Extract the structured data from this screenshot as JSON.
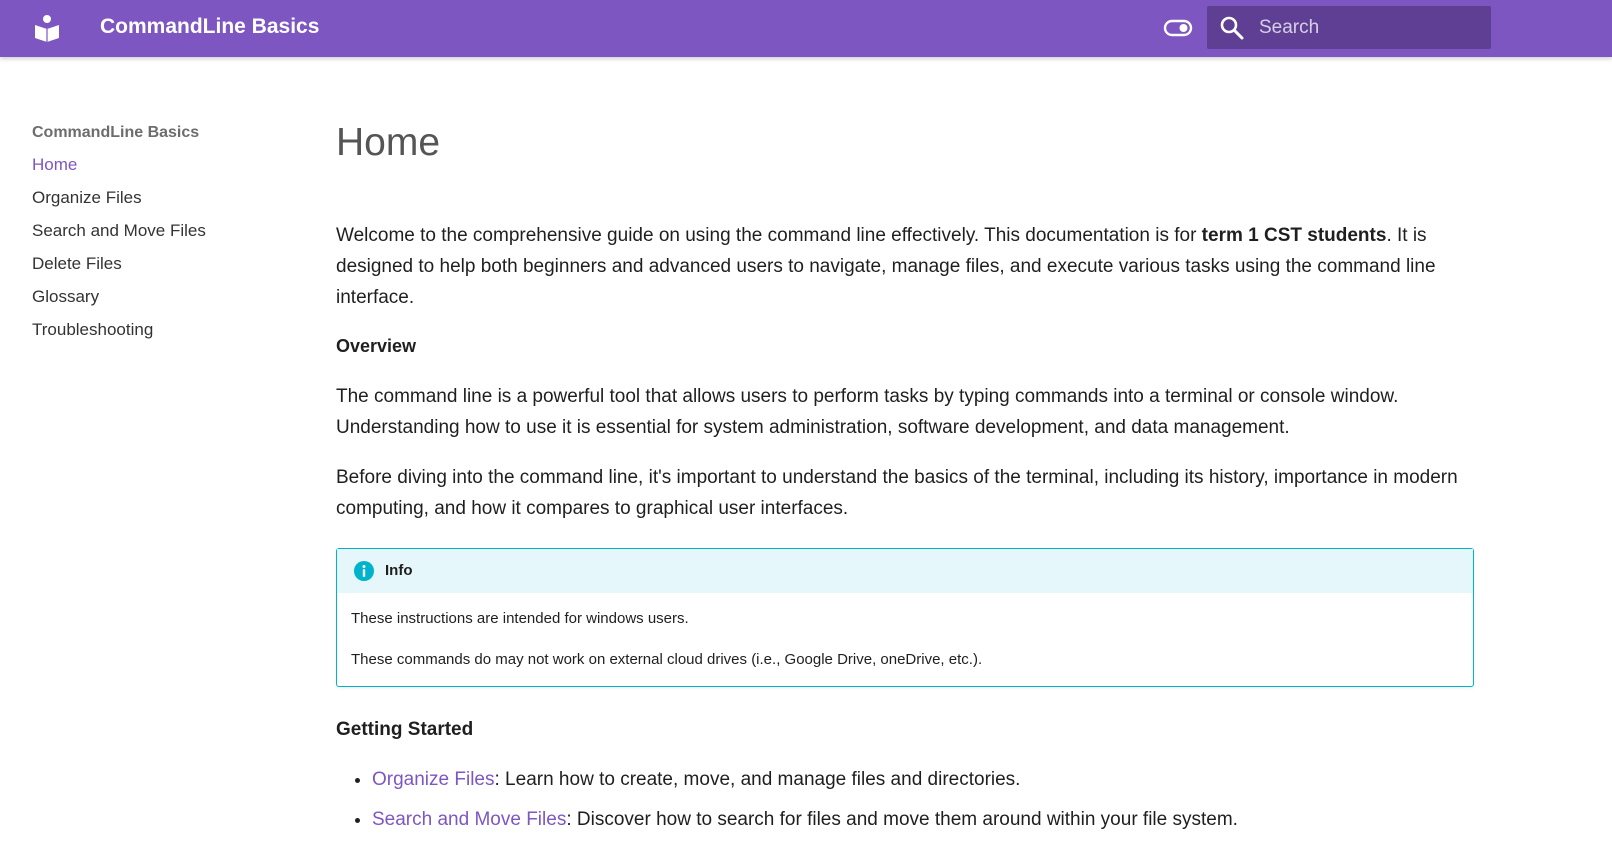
{
  "header": {
    "site_title": "CommandLine Basics",
    "search_placeholder": "Search"
  },
  "sidebar": {
    "title": "CommandLine Basics",
    "items": [
      {
        "label": "Home",
        "active": true
      },
      {
        "label": "Organize Files"
      },
      {
        "label": "Search and Move Files"
      },
      {
        "label": "Delete Files"
      },
      {
        "label": "Glossary"
      },
      {
        "label": "Troubleshooting"
      }
    ]
  },
  "main": {
    "title": "Home",
    "intro_pre": "Welcome to the comprehensive guide on using the command line effectively. This documentation is for ",
    "intro_bold": "term 1 CST students",
    "intro_post": ". It is designed to help both beginners and advanced users to navigate, manage files, and execute various tasks using the command line interface.",
    "overview_heading": "Overview",
    "overview_p1": "The command line is a powerful tool that allows users to perform tasks by typing commands into a terminal or console window. Understanding how to use it is essential for system administration, software development, and data management.",
    "overview_p2": "Before diving into the command line, it's important to understand the basics of the terminal, including its history, importance in modern computing, and how it compares to graphical user interfaces.",
    "info": {
      "title": "Info",
      "line1": "These instructions are intended for windows users.",
      "line2": "These commands do may not work on external cloud drives (i.e., Google Drive, oneDrive, etc.)."
    },
    "getting_started_heading": "Getting Started",
    "getting_started": [
      {
        "link": "Organize Files",
        "text": ": Learn how to create, move, and manage files and directories."
      },
      {
        "link": "Search and Move Files",
        "text": ": Discover how to search for files and move them around within your file system."
      }
    ]
  },
  "colors": {
    "primary": "#7e56c2",
    "search_bg": "#5e3f94",
    "info_accent": "#00b3cc",
    "info_bg": "#e5f7fa"
  }
}
